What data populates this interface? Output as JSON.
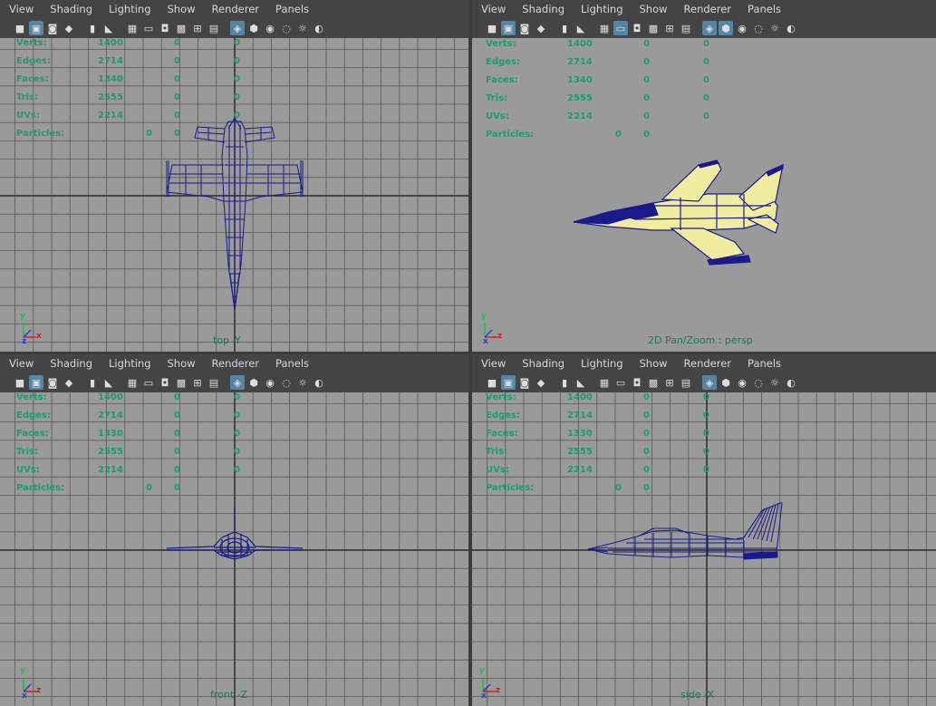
{
  "menus": [
    "View",
    "Shading",
    "Lighting",
    "Show",
    "Renderer",
    "Panels"
  ],
  "stats_labels": [
    "Verts:",
    "Edges:",
    "Faces:",
    "Tris:",
    "UVs:",
    "Particles:"
  ],
  "viewports": [
    {
      "id": "top",
      "camera": "top -Y",
      "stats": [
        [
          "1400",
          "0",
          "0"
        ],
        [
          "2714",
          "0",
          "0"
        ],
        [
          "1340",
          "0",
          "0"
        ],
        [
          "2555",
          "0",
          "0"
        ],
        [
          "2214",
          "0",
          "0"
        ],
        [
          "0",
          "0",
          ""
        ]
      ],
      "axes": [
        "y",
        "x",
        "z"
      ]
    },
    {
      "id": "persp",
      "camera": "2D Pan/Zoom : persp",
      "stats": [
        [
          "1400",
          "0",
          "0"
        ],
        [
          "2714",
          "0",
          "0"
        ],
        [
          "1340",
          "0",
          "0"
        ],
        [
          "2555",
          "0",
          "0"
        ],
        [
          "2214",
          "0",
          "0"
        ],
        [
          "0",
          "0",
          ""
        ]
      ],
      "axes": [
        "y",
        "z",
        "x"
      ]
    },
    {
      "id": "front",
      "camera": "front -Z",
      "stats": [
        [
          "1400",
          "0",
          "0"
        ],
        [
          "2714",
          "0",
          "0"
        ],
        [
          "1330",
          "0",
          "0"
        ],
        [
          "2555",
          "0",
          "0"
        ],
        [
          "2214",
          "0",
          "0"
        ],
        [
          "0",
          "0",
          ""
        ]
      ],
      "axes": [
        "y",
        "z",
        "x"
      ]
    },
    {
      "id": "side",
      "camera": "side -X",
      "stats": [
        [
          "1400",
          "0",
          "0"
        ],
        [
          "2714",
          "0",
          "0"
        ],
        [
          "1330",
          "0",
          "0"
        ],
        [
          "2555",
          "0",
          "0"
        ],
        [
          "2214",
          "0",
          "0"
        ],
        [
          "0",
          "0",
          ""
        ]
      ],
      "axes": [
        "y",
        "z",
        "x"
      ]
    }
  ],
  "colors": {
    "grid_bg": "#9a9a9a",
    "grid_line": "#5a5a5a",
    "axis_line": "#2a2a2a",
    "wire": "#1a1a8c",
    "shaded": "#f0eca0",
    "hud_text": "#1f9a6e",
    "menu_bg": "#444444",
    "highlight": "#5285a6"
  },
  "icons": [
    "camera-icon",
    "camera-select-icon",
    "camera-lock-icon",
    "film-icon",
    "bookmark-icon",
    "image-plane-icon",
    "grid-icon",
    "film-gate-icon",
    "resolution-gate-icon",
    "safe-action-icon",
    "field-chart-icon",
    "xray-icon",
    "wireframe-icon",
    "smooth-shade-icon",
    "default-material-icon",
    "textured-icon",
    "lights-icon",
    "shadows-icon"
  ]
}
